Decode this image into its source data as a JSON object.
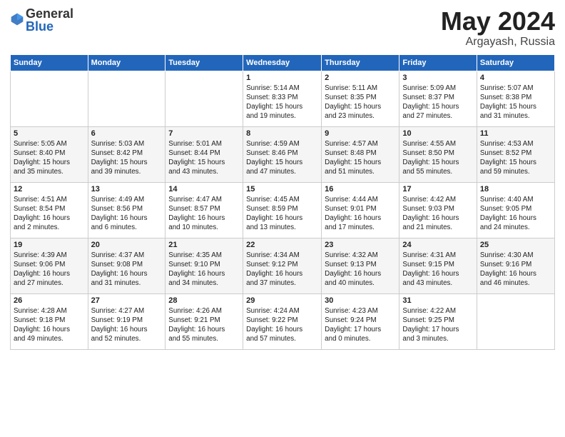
{
  "logo": {
    "general": "General",
    "blue": "Blue"
  },
  "title": {
    "month_year": "May 2024",
    "location": "Argayash, Russia"
  },
  "weekdays": [
    "Sunday",
    "Monday",
    "Tuesday",
    "Wednesday",
    "Thursday",
    "Friday",
    "Saturday"
  ],
  "weeks": [
    [
      {
        "day": "",
        "info": ""
      },
      {
        "day": "",
        "info": ""
      },
      {
        "day": "",
        "info": ""
      },
      {
        "day": "1",
        "info": "Sunrise: 5:14 AM\nSunset: 8:33 PM\nDaylight: 15 hours\nand 19 minutes."
      },
      {
        "day": "2",
        "info": "Sunrise: 5:11 AM\nSunset: 8:35 PM\nDaylight: 15 hours\nand 23 minutes."
      },
      {
        "day": "3",
        "info": "Sunrise: 5:09 AM\nSunset: 8:37 PM\nDaylight: 15 hours\nand 27 minutes."
      },
      {
        "day": "4",
        "info": "Sunrise: 5:07 AM\nSunset: 8:38 PM\nDaylight: 15 hours\nand 31 minutes."
      }
    ],
    [
      {
        "day": "5",
        "info": "Sunrise: 5:05 AM\nSunset: 8:40 PM\nDaylight: 15 hours\nand 35 minutes."
      },
      {
        "day": "6",
        "info": "Sunrise: 5:03 AM\nSunset: 8:42 PM\nDaylight: 15 hours\nand 39 minutes."
      },
      {
        "day": "7",
        "info": "Sunrise: 5:01 AM\nSunset: 8:44 PM\nDaylight: 15 hours\nand 43 minutes."
      },
      {
        "day": "8",
        "info": "Sunrise: 4:59 AM\nSunset: 8:46 PM\nDaylight: 15 hours\nand 47 minutes."
      },
      {
        "day": "9",
        "info": "Sunrise: 4:57 AM\nSunset: 8:48 PM\nDaylight: 15 hours\nand 51 minutes."
      },
      {
        "day": "10",
        "info": "Sunrise: 4:55 AM\nSunset: 8:50 PM\nDaylight: 15 hours\nand 55 minutes."
      },
      {
        "day": "11",
        "info": "Sunrise: 4:53 AM\nSunset: 8:52 PM\nDaylight: 15 hours\nand 59 minutes."
      }
    ],
    [
      {
        "day": "12",
        "info": "Sunrise: 4:51 AM\nSunset: 8:54 PM\nDaylight: 16 hours\nand 2 minutes."
      },
      {
        "day": "13",
        "info": "Sunrise: 4:49 AM\nSunset: 8:56 PM\nDaylight: 16 hours\nand 6 minutes."
      },
      {
        "day": "14",
        "info": "Sunrise: 4:47 AM\nSunset: 8:57 PM\nDaylight: 16 hours\nand 10 minutes."
      },
      {
        "day": "15",
        "info": "Sunrise: 4:45 AM\nSunset: 8:59 PM\nDaylight: 16 hours\nand 13 minutes."
      },
      {
        "day": "16",
        "info": "Sunrise: 4:44 AM\nSunset: 9:01 PM\nDaylight: 16 hours\nand 17 minutes."
      },
      {
        "day": "17",
        "info": "Sunrise: 4:42 AM\nSunset: 9:03 PM\nDaylight: 16 hours\nand 21 minutes."
      },
      {
        "day": "18",
        "info": "Sunrise: 4:40 AM\nSunset: 9:05 PM\nDaylight: 16 hours\nand 24 minutes."
      }
    ],
    [
      {
        "day": "19",
        "info": "Sunrise: 4:39 AM\nSunset: 9:06 PM\nDaylight: 16 hours\nand 27 minutes."
      },
      {
        "day": "20",
        "info": "Sunrise: 4:37 AM\nSunset: 9:08 PM\nDaylight: 16 hours\nand 31 minutes."
      },
      {
        "day": "21",
        "info": "Sunrise: 4:35 AM\nSunset: 9:10 PM\nDaylight: 16 hours\nand 34 minutes."
      },
      {
        "day": "22",
        "info": "Sunrise: 4:34 AM\nSunset: 9:12 PM\nDaylight: 16 hours\nand 37 minutes."
      },
      {
        "day": "23",
        "info": "Sunrise: 4:32 AM\nSunset: 9:13 PM\nDaylight: 16 hours\nand 40 minutes."
      },
      {
        "day": "24",
        "info": "Sunrise: 4:31 AM\nSunset: 9:15 PM\nDaylight: 16 hours\nand 43 minutes."
      },
      {
        "day": "25",
        "info": "Sunrise: 4:30 AM\nSunset: 9:16 PM\nDaylight: 16 hours\nand 46 minutes."
      }
    ],
    [
      {
        "day": "26",
        "info": "Sunrise: 4:28 AM\nSunset: 9:18 PM\nDaylight: 16 hours\nand 49 minutes."
      },
      {
        "day": "27",
        "info": "Sunrise: 4:27 AM\nSunset: 9:19 PM\nDaylight: 16 hours\nand 52 minutes."
      },
      {
        "day": "28",
        "info": "Sunrise: 4:26 AM\nSunset: 9:21 PM\nDaylight: 16 hours\nand 55 minutes."
      },
      {
        "day": "29",
        "info": "Sunrise: 4:24 AM\nSunset: 9:22 PM\nDaylight: 16 hours\nand 57 minutes."
      },
      {
        "day": "30",
        "info": "Sunrise: 4:23 AM\nSunset: 9:24 PM\nDaylight: 17 hours\nand 0 minutes."
      },
      {
        "day": "31",
        "info": "Sunrise: 4:22 AM\nSunset: 9:25 PM\nDaylight: 17 hours\nand 3 minutes."
      },
      {
        "day": "",
        "info": ""
      }
    ]
  ]
}
